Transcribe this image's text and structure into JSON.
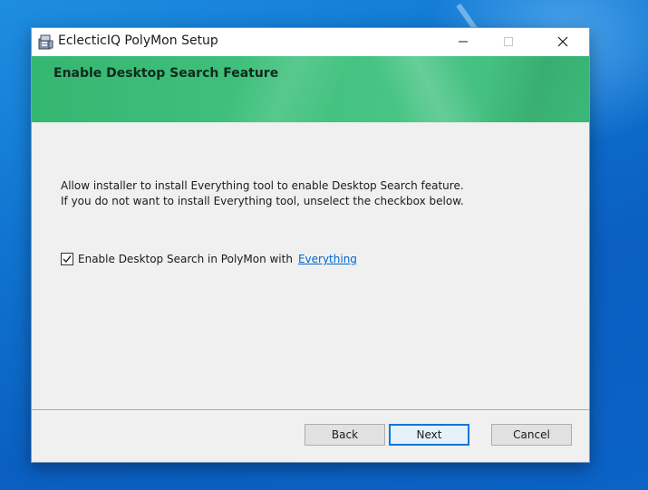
{
  "window": {
    "title": "EclecticIQ PolyMon Setup"
  },
  "banner": {
    "title": "Enable Desktop Search Feature"
  },
  "content": {
    "description_line1": "Allow installer to install Everything tool to enable Desktop Search feature.",
    "description_line2": "If you do not want to install Everything tool, unselect the checkbox below.",
    "checkbox_label": "Enable Desktop Search in PolyMon with",
    "checkbox_link": "Everything",
    "checkbox_checked": true
  },
  "buttons": {
    "back": "Back",
    "next": "Next",
    "cancel": "Cancel"
  },
  "icons": {
    "app": "installer-package-icon",
    "minimize": "minimize-icon",
    "maximize": "maximize-icon",
    "close": "close-icon",
    "check": "checkmark-icon"
  },
  "colors": {
    "banner_green": "#3fc07c",
    "link_blue": "#0066cc",
    "focus_blue": "#0078d7",
    "desktop_blue": "#0f73cf"
  }
}
